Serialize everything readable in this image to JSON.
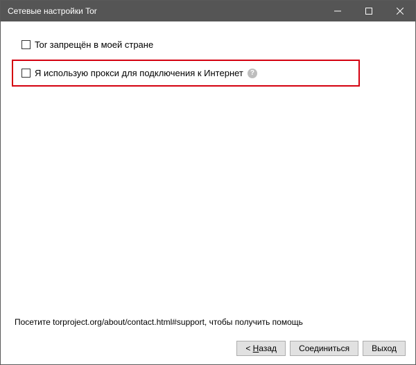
{
  "titlebar": {
    "title": "Сетевые настройки Tor"
  },
  "options": {
    "censored_label": "Tor запрещён в моей стране",
    "proxy_label": "Я использую прокси для подключения к Интернет"
  },
  "footer": {
    "text": "Посетите torproject.org/about/contact.html#support, чтобы получить помощь"
  },
  "buttons": {
    "back_prefix": "< ",
    "back_u": "Н",
    "back_rest": "азад",
    "connect": "Соединиться",
    "exit": "Выход"
  }
}
